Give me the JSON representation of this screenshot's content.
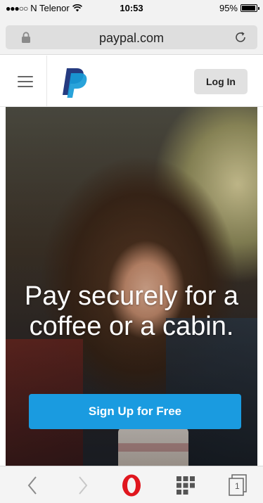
{
  "status_bar": {
    "signal": "●●●○○",
    "carrier": "N Telenor",
    "wifi_icon": "wifi-icon",
    "time": "10:53",
    "battery_percent": "95%",
    "battery_level": 0.95
  },
  "url_bar": {
    "url": "paypal.com",
    "lock_icon": "lock-icon",
    "reload_icon": "reload-icon"
  },
  "header": {
    "menu_icon": "hamburger-menu-icon",
    "logo_icon": "paypal-logo-icon",
    "login_label": "Log In"
  },
  "hero": {
    "headline_line1": "Pay securely for a",
    "headline_line2": "coffee or a cabin.",
    "signup_label": "Sign Up for Free"
  },
  "toolbar": {
    "back_icon": "chevron-left-icon",
    "forward_icon": "chevron-right-icon",
    "opera_icon": "opera-logo-icon",
    "speed_dial_icon": "speed-dial-grid-icon",
    "tabs_icon": "tabs-icon",
    "tabs_count": "1"
  },
  "colors": {
    "accent": "#1a9be0",
    "paypal_dark_blue": "#253b80",
    "paypal_light_blue": "#179bd7",
    "opera_red": "#e0161e"
  }
}
